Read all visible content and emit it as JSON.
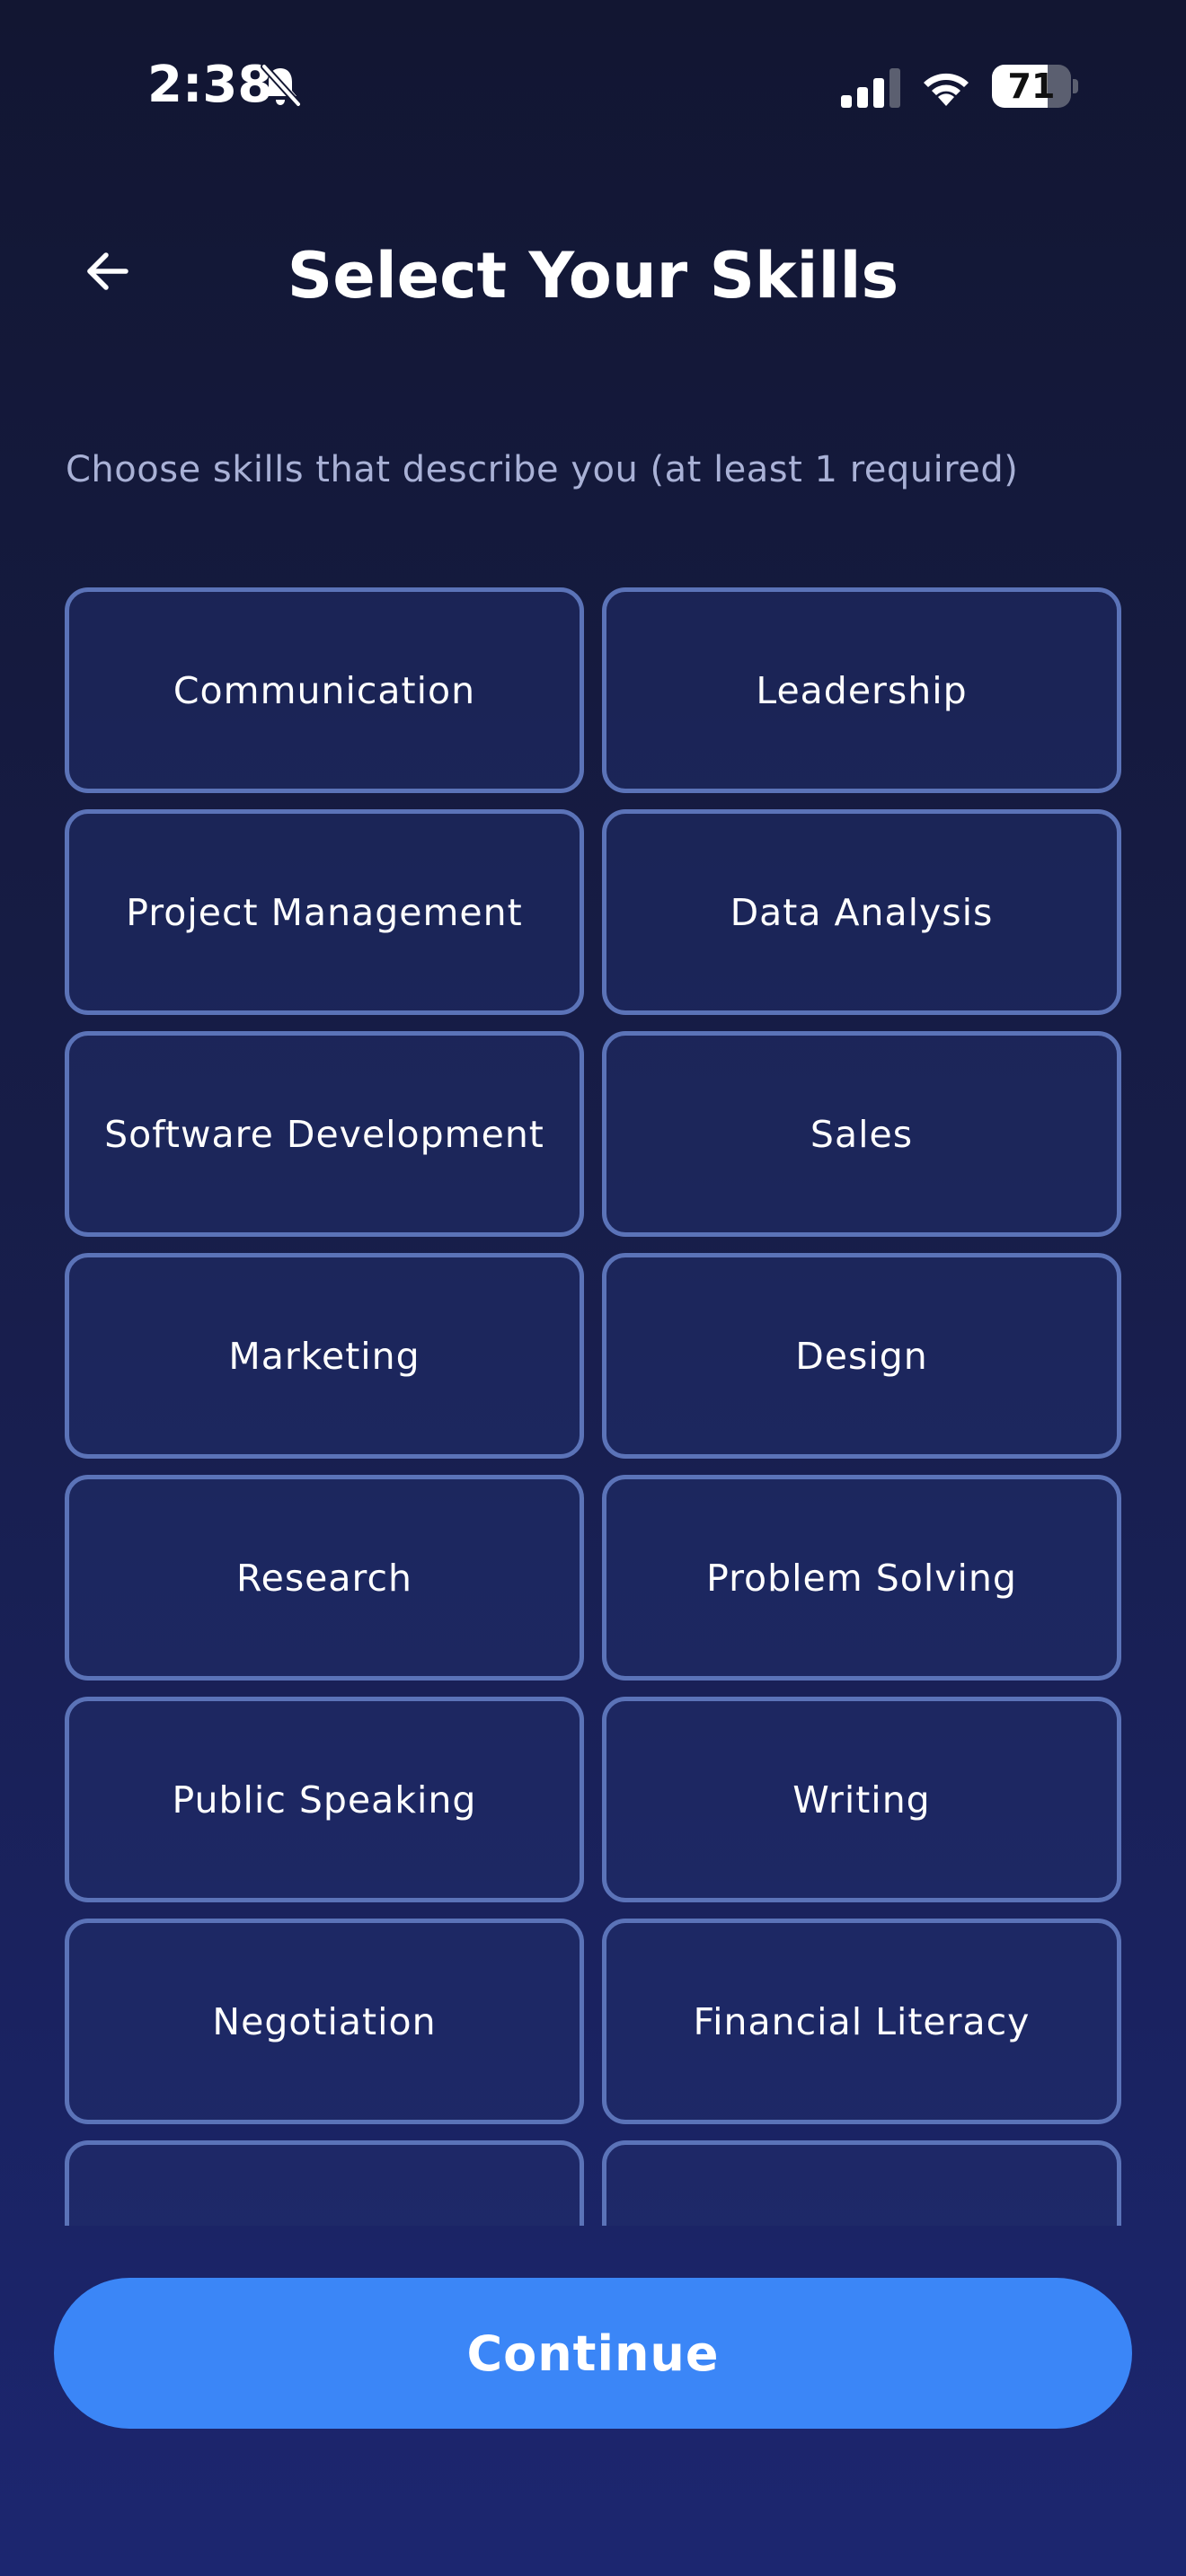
{
  "status_bar": {
    "time": "2:38",
    "battery_level": "71",
    "battery_fraction": 0.71,
    "icons": [
      "bell-slash-icon",
      "cellular-signal-icon",
      "wifi-icon",
      "battery-icon"
    ]
  },
  "header": {
    "title": "Select Your Skills",
    "back_icon": "arrow-left-icon"
  },
  "subtitle": "Choose skills that describe you (at least 1 required)",
  "skills": [
    {
      "label": "Communication"
    },
    {
      "label": "Leadership"
    },
    {
      "label": "Project Management"
    },
    {
      "label": "Data Analysis"
    },
    {
      "label": "Software Development"
    },
    {
      "label": "Sales"
    },
    {
      "label": "Marketing"
    },
    {
      "label": "Design"
    },
    {
      "label": "Research"
    },
    {
      "label": "Problem Solving"
    },
    {
      "label": "Public Speaking"
    },
    {
      "label": "Writing"
    },
    {
      "label": "Negotiation"
    },
    {
      "label": "Financial Literacy"
    },
    {
      "label": ""
    },
    {
      "label": ""
    }
  ],
  "continue_label": "Continue",
  "colors": {
    "accent": "#3b86f7",
    "card_border": "#5b73b8",
    "background_top": "#121632",
    "background_bottom": "#1c2670"
  }
}
